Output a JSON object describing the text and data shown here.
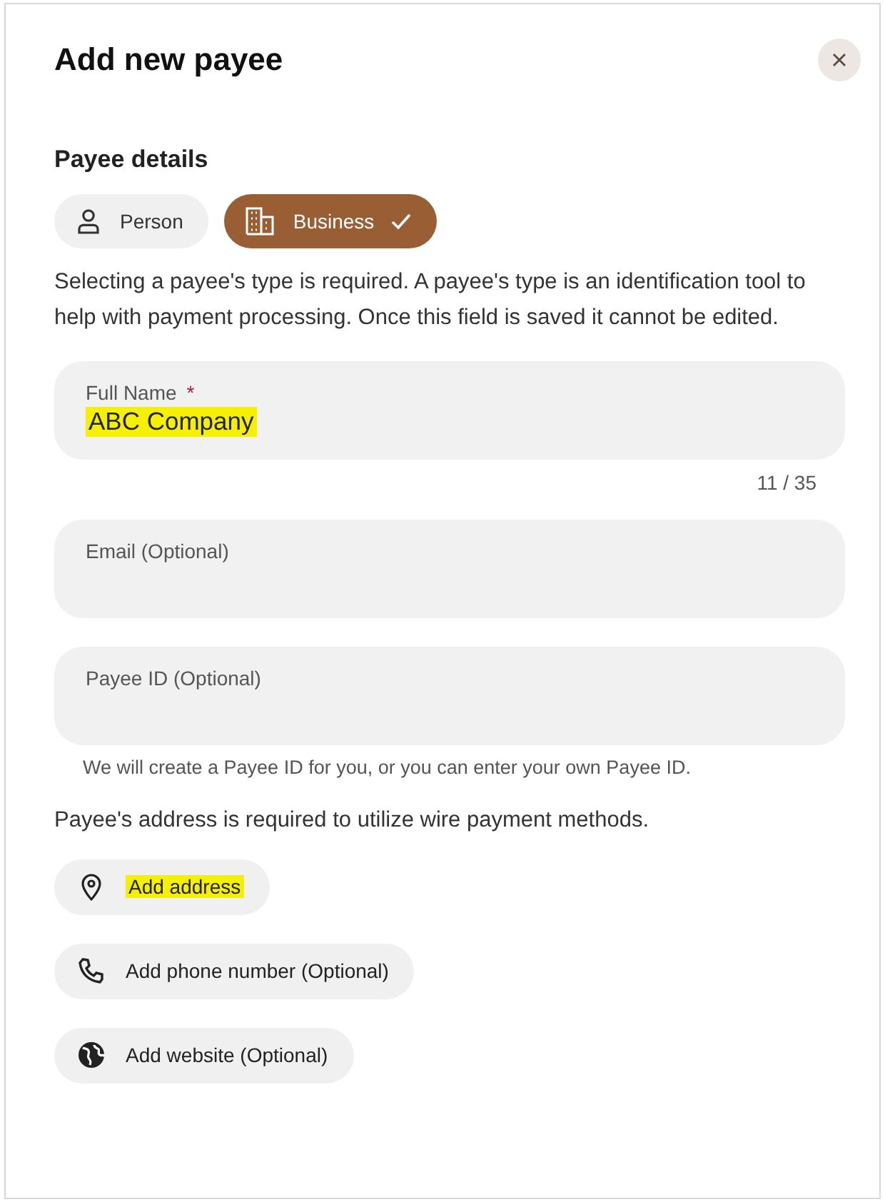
{
  "dialog": {
    "title": "Add new payee"
  },
  "section_title": "Payee details",
  "payee_types": [
    {
      "kind": "person",
      "label": "Person",
      "selected": false
    },
    {
      "kind": "business",
      "label": "Business",
      "selected": true
    }
  ],
  "type_note": "Selecting a payee's type is required. A payee's type is an identification tool to help with payment processing. Once this field is saved it cannot be edited.",
  "fields": [
    {
      "label": "Full Name",
      "required_mark": "*",
      "value": "ABC Company",
      "highlighted": true,
      "counter": "11 / 35"
    },
    {
      "label": "Email (Optional)"
    },
    {
      "label": "Payee ID (Optional)",
      "hint": "We will create a Payee ID for you, or you can enter your own Payee ID."
    }
  ],
  "address_note": "Payee's address is required to utilize wire payment methods.",
  "actions": [
    {
      "kind": "address",
      "label": "Add address",
      "highlighted": true
    },
    {
      "kind": "phone",
      "label": "Add phone number (Optional)",
      "highlighted": false
    },
    {
      "kind": "website",
      "label": "Add website (Optional)",
      "highlighted": false
    }
  ]
}
